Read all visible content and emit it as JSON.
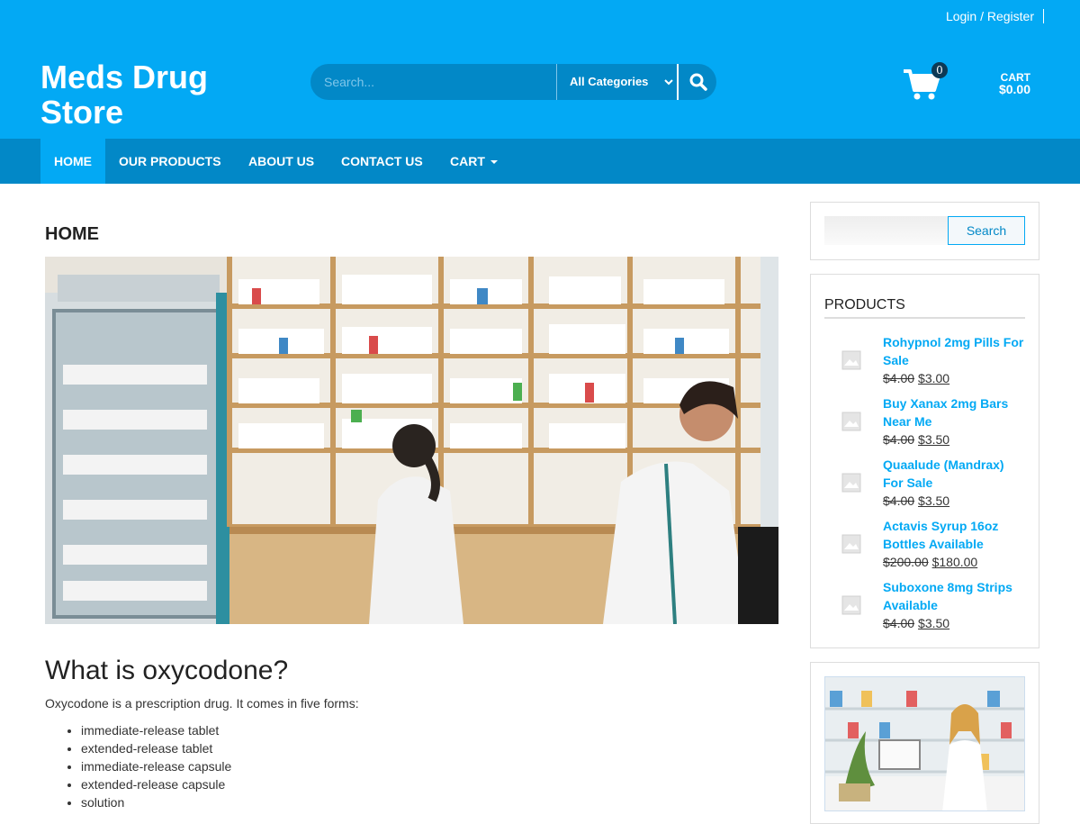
{
  "topbar": {
    "login_label": "Login / Register"
  },
  "header": {
    "site_title": "Meds Drug Store",
    "search_placeholder": "Search...",
    "category_selected": "All Categories",
    "cart_count": "0",
    "cart_label": "CART",
    "cart_total": "$0.00",
    "icons": {
      "search": "search-icon",
      "cart": "cart-icon",
      "dropdown": "chevron-down-icon"
    }
  },
  "nav": {
    "items": [
      {
        "label": "HOME",
        "active": true
      },
      {
        "label": "OUR PRODUCTS"
      },
      {
        "label": "ABOUT US"
      },
      {
        "label": "CONTACT US"
      },
      {
        "label": "CART",
        "has_dropdown": true
      }
    ]
  },
  "main": {
    "page_heading": "HOME",
    "article_title": "What is oxycodone?",
    "article_intro": "Oxycodone is a prescription drug. It comes in five forms:",
    "forms": [
      "immediate-release tablet",
      "extended-release tablet",
      "immediate-release capsule",
      "extended-release capsule",
      "solution"
    ]
  },
  "sidebar": {
    "search_button": "Search",
    "products_title": "PRODUCTS",
    "products": [
      {
        "name": "Rohypnol 2mg Pills For Sale",
        "old_price": "$4.00",
        "price": "$3.00"
      },
      {
        "name": "Buy Xanax 2mg Bars Near Me",
        "old_price": "$4.00",
        "price": "$3.50"
      },
      {
        "name": "Quaalude (Mandrax) For Sale",
        "old_price": "$4.00",
        "price": "$3.50"
      },
      {
        "name": "Actavis Syrup 16oz Bottles Available",
        "old_price": "$200.00",
        "price": "$180.00"
      },
      {
        "name": "Suboxone 8mg Strips Available",
        "old_price": "$4.00",
        "price": "$3.50"
      }
    ]
  },
  "colors": {
    "primary": "#03a9f4",
    "primary_dark": "#0288c7",
    "link": "#03a9f4"
  }
}
